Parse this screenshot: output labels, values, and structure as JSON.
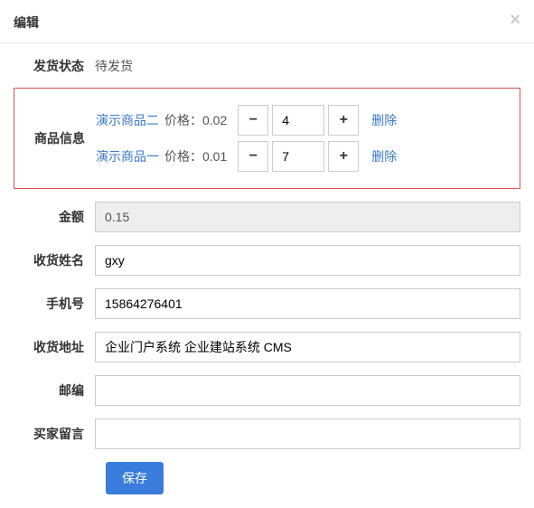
{
  "modal": {
    "title": "编辑",
    "close": "×"
  },
  "status": {
    "label": "发货状态",
    "value": "待发货"
  },
  "products": {
    "label": "商品信息",
    "price_prefix": "价格：",
    "items": [
      {
        "name": "演示商品二",
        "price": "0.02",
        "qty": "4",
        "delete": "删除"
      },
      {
        "name": "演示商品一",
        "price": "0.01",
        "qty": "7",
        "delete": "删除"
      }
    ]
  },
  "amount": {
    "label": "金额",
    "value": "0.15"
  },
  "name": {
    "label": "收货姓名",
    "value": "gxy"
  },
  "phone": {
    "label": "手机号",
    "value": "15864276401"
  },
  "address": {
    "label": "收货地址",
    "value": "企业门户系统 企业建站系统 CMS"
  },
  "zip": {
    "label": "邮编",
    "value": ""
  },
  "note": {
    "label": "买家留言",
    "value": ""
  },
  "actions": {
    "save": "保存"
  },
  "icons": {
    "minus": "−",
    "plus": "+"
  }
}
